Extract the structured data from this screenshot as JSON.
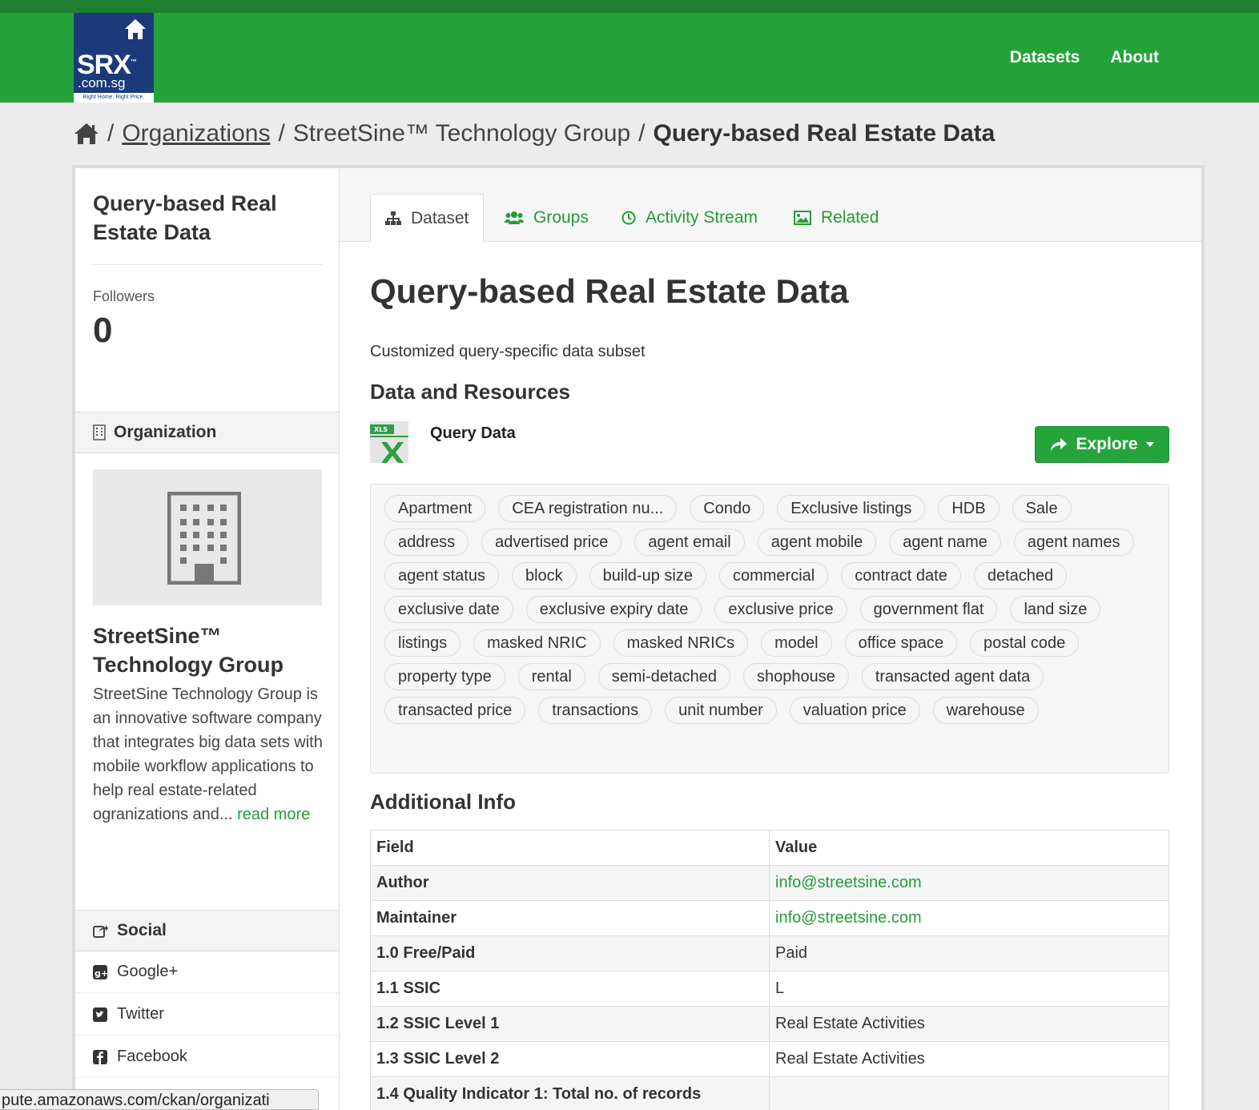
{
  "header": {
    "logo": {
      "brand": "SRX",
      "domain": ".com.sg",
      "tagline": "Right Home. Right Price."
    },
    "nav": [
      "Datasets",
      "About"
    ]
  },
  "breadcrumb": {
    "organizations": "Organizations",
    "organization": "StreetSine™ Technology Group",
    "current": "Query-based Real Estate Data"
  },
  "sidebar": {
    "title": "Query-based Real Estate Data",
    "followers_label": "Followers",
    "followers_count": "0",
    "organization_heading": "Organization",
    "org_name": "StreetSine™ Technology Group",
    "org_description": "StreetSine Technology Group is an innovative software company that integrates big data sets with mobile workflow applications to help real estate-related ogranizations and...",
    "read_more": "read more",
    "social_heading": "Social",
    "social": [
      "Google+",
      "Twitter",
      "Facebook"
    ]
  },
  "tabs": [
    "Dataset",
    "Groups",
    "Activity Stream",
    "Related"
  ],
  "dataset": {
    "title": "Query-based Real Estate Data",
    "notes": "Customized query-specific data subset",
    "resources_heading": "Data and Resources",
    "resource": {
      "format": "XLS",
      "name": "Query Data",
      "explore_label": "Explore"
    },
    "tags": [
      "Apartment",
      "CEA registration nu...",
      "Condo",
      "Exclusive listings",
      "HDB",
      "Sale",
      "address",
      "advertised price",
      "agent email",
      "agent mobile",
      "agent name",
      "agent names",
      "agent status",
      "block",
      "build-up size",
      "commercial",
      "contract date",
      "detached",
      "exclusive date",
      "exclusive expiry date",
      "exclusive price",
      "government flat",
      "land size",
      "listings",
      "masked NRIC",
      "masked NRICs",
      "model",
      "office space",
      "postal code",
      "property type",
      "rental",
      "semi-detached",
      "shophouse",
      "transacted agent data",
      "transacted price",
      "transactions",
      "unit number",
      "valuation price",
      "warehouse"
    ],
    "additional_info_heading": "Additional Info",
    "table": {
      "headers": [
        "Field",
        "Value"
      ],
      "rows": [
        {
          "field": "Author",
          "value": "info@streetsine.com",
          "link": true
        },
        {
          "field": "Maintainer",
          "value": "info@streetsine.com",
          "link": true
        },
        {
          "field": "1.0 Free/Paid",
          "value": "Paid"
        },
        {
          "field": "1.1 SSIC",
          "value": "L"
        },
        {
          "field": "1.2 SSIC Level 1",
          "value": "Real Estate Activities"
        },
        {
          "field": "1.3 SSIC Level 2",
          "value": "Real Estate Activities"
        },
        {
          "field": "1.4 Quality Indicator 1: Total no. of records",
          "value": ""
        }
      ]
    }
  },
  "statusbar": "pute.amazonaws.com/ckan/organizati",
  "colors": {
    "brand_green": "#23a33a",
    "link_green": "#249b38",
    "logo_blue": "#1b3a7a"
  }
}
